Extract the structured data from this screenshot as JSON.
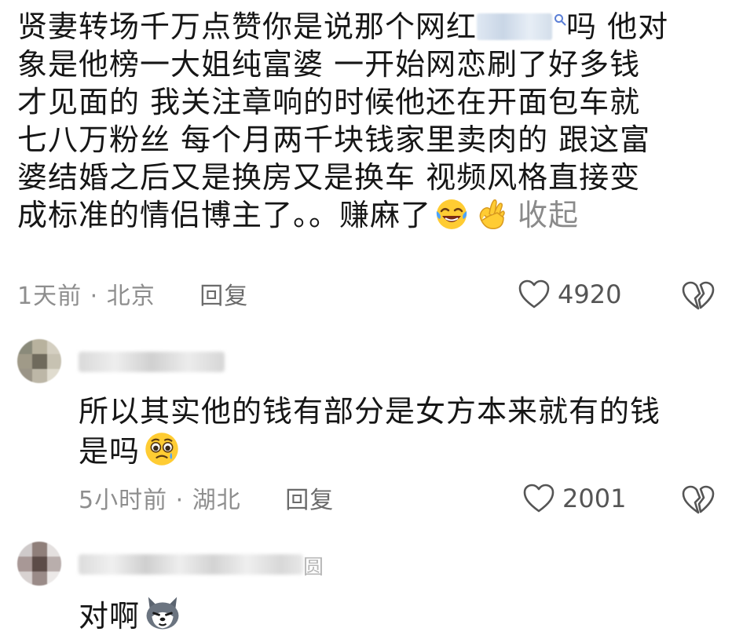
{
  "comments": [
    {
      "lines": [
        {
          "before": "贤妻转场千万点赞你是说那个网红",
          "after": "吗 他对"
        },
        {
          "text": "象是他榜一大姐纯富婆 一开始网恋刷了好多钱"
        },
        {
          "text": "才见面的 我关注章响的时候他还在开面包车就"
        },
        {
          "text": "七八万粉丝 每个月两千块钱家里卖肉的 跟这富"
        },
        {
          "text": "婆结婚之后又是换房又是换车 视频风格直接变"
        },
        {
          "text": "成标准的情侣博主了。。赚麻了"
        }
      ],
      "emojis": [
        "laughing-tears-emoji",
        "ok-hand-emoji"
      ],
      "collapse_label": "收起",
      "time": "1天前",
      "location": "北京",
      "reply_label": "回复",
      "likes": "4920"
    },
    {
      "lines": [
        {
          "text": "所以其实他的钱有部分是女方本来就有的钱"
        },
        {
          "text": "是吗"
        }
      ],
      "emojis": [
        "pleading-face-emoji"
      ],
      "time": "5小时前",
      "location": "湖北",
      "reply_label": "回复",
      "likes": "2001"
    },
    {
      "username_tail": "圆",
      "lines": [
        {
          "text": "对啊"
        }
      ],
      "emojis": [
        "husky-dog-emoji"
      ]
    }
  ],
  "separator": "·",
  "icons": {
    "like": "heart-outline-icon",
    "dislike": "broken-heart-icon",
    "search": "search-icon"
  },
  "colors": {
    "text": "#161616",
    "meta": "#8e8e8e",
    "collapse": "#8a8a8a"
  }
}
